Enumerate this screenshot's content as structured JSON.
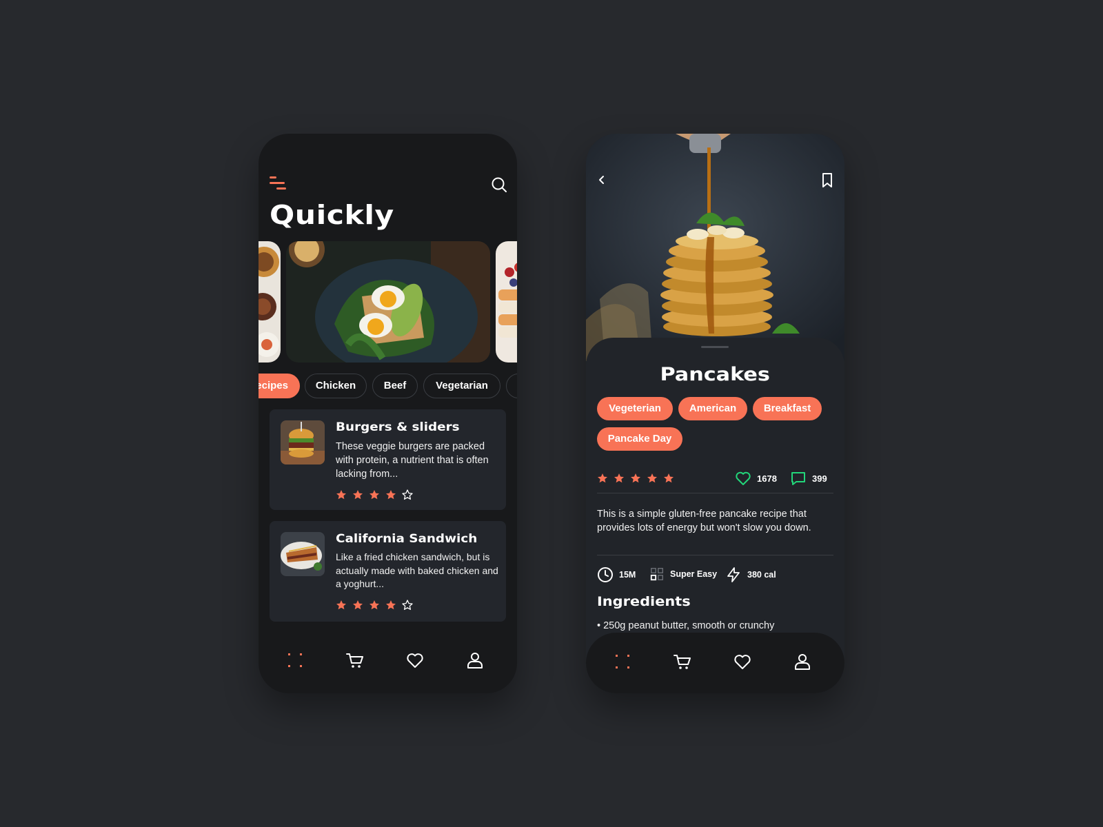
{
  "colors": {
    "accent": "#f87356",
    "green": "#22d67a",
    "background": "#27292d",
    "card": "#23262c",
    "phone": "#18191b"
  },
  "home": {
    "title": "Quickly",
    "icons": {
      "menu": "menu-icon",
      "search": "search-icon"
    },
    "categories": [
      {
        "label": "Recipes",
        "visible_label": "ecipes",
        "active": true
      },
      {
        "label": "Chicken",
        "active": false
      },
      {
        "label": "Beef",
        "active": false
      },
      {
        "label": "Vegetarian",
        "active": false
      }
    ],
    "recipes": [
      {
        "title": "Burgers & sliders",
        "description": "These veggie burgers are packed with protein, a nutrient that is often lacking from...",
        "rating": 4,
        "max_rating": 5
      },
      {
        "title": "California Sandwich",
        "description": "Like a fried chicken sandwich, but is actually made with baked chicken and a yoghurt...",
        "rating": 4,
        "max_rating": 5
      }
    ]
  },
  "detail": {
    "title": "Pancakes",
    "tags": [
      "Vegeterian",
      "American",
      "Breakfast",
      "Pancake Day"
    ],
    "rating": 5,
    "max_rating": 5,
    "likes": "1678",
    "comments": "399",
    "description": "This is a simple gluten-free pancake recipe that provides lots of energy but won't slow you down.",
    "time": "15M",
    "difficulty": "Super Easy",
    "calories": "380 cal",
    "ingredients_title": "Ingredients",
    "ingredients": [
      "• 250g peanut butter, smooth or crunchy"
    ]
  },
  "nav": [
    "grid-icon",
    "cart-icon",
    "heart-icon",
    "user-icon"
  ]
}
